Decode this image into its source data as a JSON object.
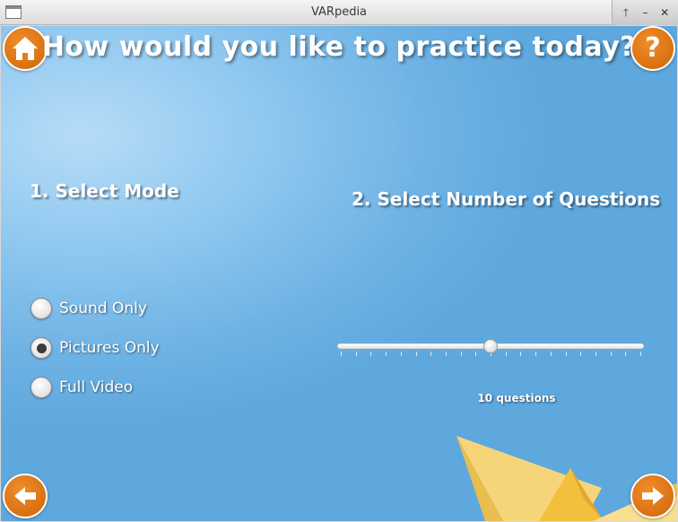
{
  "window": {
    "title": "VARpedia",
    "controls": {
      "maximize": "🡑",
      "minimize": "–",
      "close": "✕"
    }
  },
  "header": {
    "title": "How would you like to practice today?",
    "home_icon": "home-icon",
    "help_icon": "help-icon",
    "help_glyph": "?"
  },
  "mode_section": {
    "label": "1. Select Mode",
    "options": [
      {
        "label": "Sound Only",
        "selected": false
      },
      {
        "label": "Pictures Only",
        "selected": true
      },
      {
        "label": "Full Video",
        "selected": false
      }
    ]
  },
  "questions_section": {
    "label": "2. Select Number of Questions",
    "slider_fraction": 0.5,
    "value_text": "10 questions"
  },
  "footer": {
    "back_icon": "arrow-left-icon",
    "next_icon": "arrow-right-icon"
  },
  "colors": {
    "accent_orange": "#e07a17",
    "background_blue": "#6db2e4",
    "boat_yellow": "#f2cf6a"
  }
}
